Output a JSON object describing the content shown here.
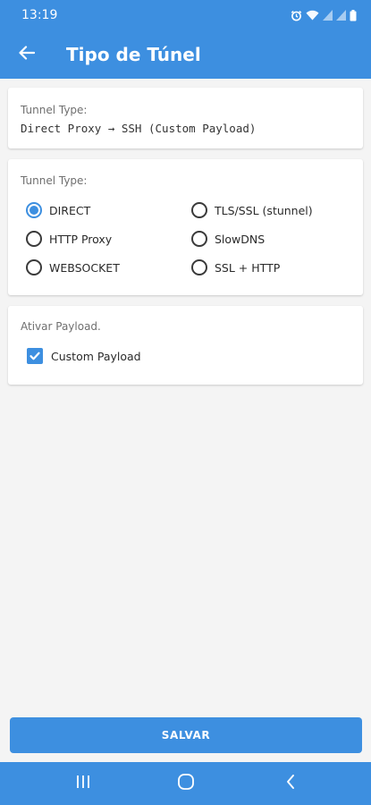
{
  "status_bar": {
    "time": "13:19",
    "icons": [
      "alarm-icon",
      "wifi-icon",
      "signal-icon",
      "signal-icon",
      "battery-icon"
    ]
  },
  "app_bar": {
    "title": "Tipo de Túnel",
    "back_icon": "arrow-left-icon"
  },
  "summary_card": {
    "label": "Tunnel Type:",
    "value": "Direct Proxy → SSH (Custom Payload)"
  },
  "tunnel_card": {
    "label": "Tunnel Type:",
    "options": [
      {
        "label": "DIRECT",
        "selected": true
      },
      {
        "label": "TLS/SSL (stunnel)",
        "selected": false
      },
      {
        "label": "HTTP Proxy",
        "selected": false
      },
      {
        "label": "SlowDNS",
        "selected": false
      },
      {
        "label": "WEBSOCKET",
        "selected": false
      },
      {
        "label": "SSL + HTTP",
        "selected": false
      }
    ]
  },
  "payload_card": {
    "label": "Ativar Payload.",
    "checkbox_label": "Custom Payload",
    "checked": true
  },
  "save_button": {
    "label": "SALVAR"
  },
  "nav_bar": {
    "icons": [
      "recent-apps-icon",
      "home-icon",
      "back-icon"
    ]
  },
  "colors": {
    "accent": "#3d8fe0",
    "background": "#f4f4f4"
  }
}
